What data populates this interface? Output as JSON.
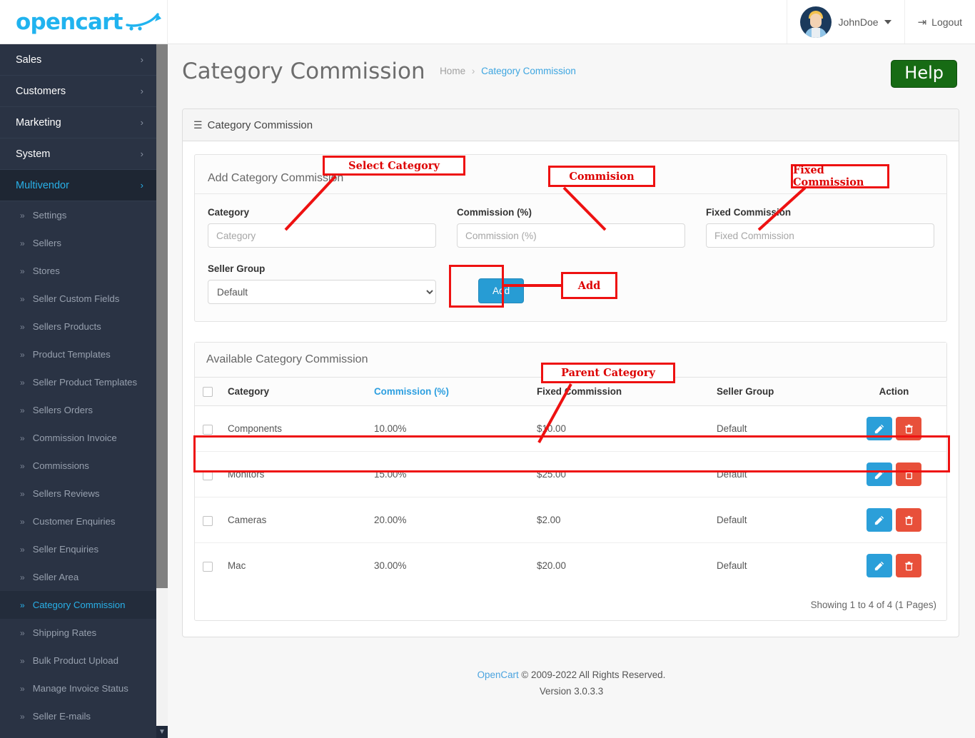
{
  "header": {
    "logo_text": "opencart",
    "logo_icon": "cart-swoosh-icon",
    "user_name": "JohnDoe",
    "logout_label": "Logout",
    "logout_icon": "logout-icon",
    "avatar_icon": "avatar",
    "accent_color": "#20b3ef"
  },
  "sidebar": {
    "top_items": [
      {
        "label": "Sales",
        "active": false
      },
      {
        "label": "Customers",
        "active": false
      },
      {
        "label": "Marketing",
        "active": false
      },
      {
        "label": "System",
        "active": false
      },
      {
        "label": "Multivendor",
        "active": true
      }
    ],
    "sub_items": [
      {
        "label": "Settings",
        "active": false
      },
      {
        "label": "Sellers",
        "active": false
      },
      {
        "label": "Stores",
        "active": false
      },
      {
        "label": "Seller Custom Fields",
        "active": false
      },
      {
        "label": "Sellers Products",
        "active": false
      },
      {
        "label": "Product Templates",
        "active": false
      },
      {
        "label": "Seller Product Templates",
        "active": false
      },
      {
        "label": "Sellers Orders",
        "active": false
      },
      {
        "label": "Commission Invoice",
        "active": false
      },
      {
        "label": "Commissions",
        "active": false
      },
      {
        "label": "Sellers Reviews",
        "active": false
      },
      {
        "label": "Customer Enquiries",
        "active": false
      },
      {
        "label": "Seller Enquiries",
        "active": false
      },
      {
        "label": "Seller Area",
        "active": false
      },
      {
        "label": "Category Commission",
        "active": true
      },
      {
        "label": "Shipping Rates",
        "active": false
      },
      {
        "label": "Bulk Product Upload",
        "active": false
      },
      {
        "label": "Manage Invoice Status",
        "active": false
      },
      {
        "label": "Seller E-mails",
        "active": false
      }
    ]
  },
  "page": {
    "title": "Category Commission",
    "breadcrumb_home": "Home",
    "breadcrumb_sep": "›",
    "breadcrumb_current": "Category Commission",
    "help_label": "Help",
    "help_color": "#176b14"
  },
  "panel": {
    "title": "Category Commission",
    "icon": "list-icon"
  },
  "form": {
    "legend": "Add Category Commission",
    "category_label": "Category",
    "category_value": "",
    "category_placeholder": "Category",
    "commission_label": "Commission (%)",
    "commission_value": "",
    "commission_placeholder": "Commission (%)",
    "fixed_label": "Fixed Commission",
    "fixed_value": "",
    "fixed_placeholder": "Fixed Commission",
    "seller_group_label": "Seller Group",
    "seller_group_selected": "Default",
    "seller_group_options": [
      "Default"
    ],
    "add_label": "Add",
    "add_color": "#279cd4"
  },
  "table": {
    "legend": "Available Category Commission",
    "columns": [
      {
        "label": "",
        "name": "select-all"
      },
      {
        "label": "Category",
        "name": "category"
      },
      {
        "label": "Commission (%)",
        "name": "commission",
        "accent": true
      },
      {
        "label": "Fixed Commission",
        "name": "fixed-commission"
      },
      {
        "label": "Seller Group",
        "name": "seller-group"
      },
      {
        "label": "Action",
        "name": "action"
      }
    ],
    "rows": [
      {
        "category": "Components",
        "commission": "10.00%",
        "fixed": "$10.00",
        "seller_group": "Default"
      },
      {
        "category": "Monitors",
        "commission": "15.00%",
        "fixed": "$25.00",
        "seller_group": "Default"
      },
      {
        "category": "Cameras",
        "commission": "20.00%",
        "fixed": "$2.00",
        "seller_group": "Default"
      },
      {
        "category": "Mac",
        "commission": "30.00%",
        "fixed": "$20.00",
        "seller_group": "Default"
      }
    ],
    "edit_icon": "edit-icon",
    "delete_icon": "trash-icon",
    "showing": "Showing 1 to 4 of 4 (1 Pages)"
  },
  "footer": {
    "link": "OpenCart",
    "copyright": " © 2009-2022 All Rights Reserved.",
    "version": "Version 3.0.3.3"
  },
  "annotations": {
    "color": "#ee1111",
    "callouts": [
      {
        "label": "Select Category"
      },
      {
        "label": "Commision"
      },
      {
        "label": "Fixed Commission"
      },
      {
        "label": "Add"
      },
      {
        "label": "Parent Category"
      }
    ]
  }
}
